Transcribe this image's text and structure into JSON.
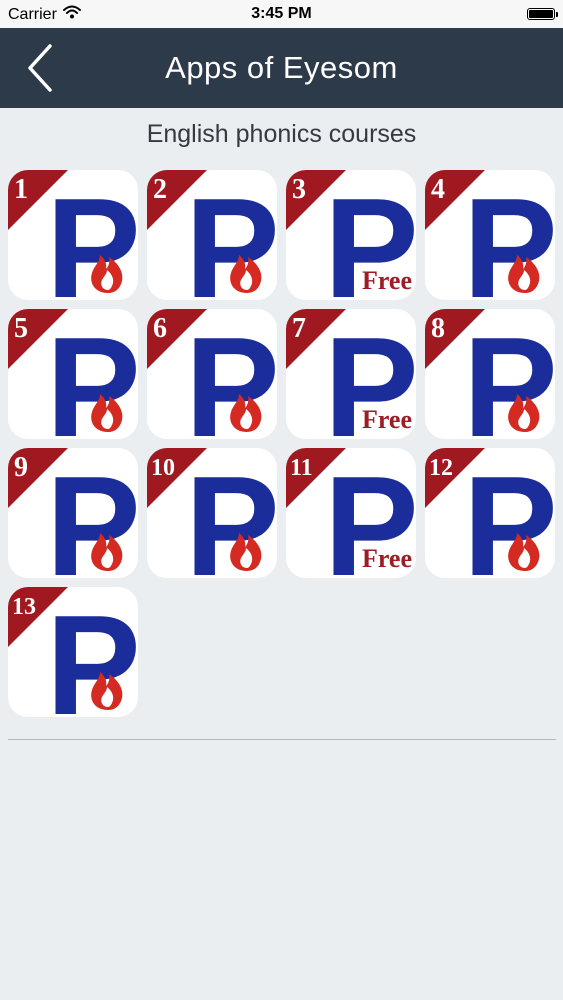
{
  "status_bar": {
    "carrier": "Carrier",
    "time": "3:45 PM"
  },
  "nav": {
    "title": "Apps of Eyesom",
    "back_icon": "chevron-left-icon"
  },
  "section": {
    "title": "English phonics courses"
  },
  "colors": {
    "nav_background": "#2d3a49",
    "page_background": "#ebeef0",
    "badge_red": "#a01820",
    "p_blue": "#1a2d9a",
    "flame_red": "#d42a21"
  },
  "apps": [
    {
      "number": "1",
      "letter": "P",
      "corner": "flame-icon"
    },
    {
      "number": "2",
      "letter": "P",
      "corner": "flame-icon"
    },
    {
      "number": "3",
      "letter": "P",
      "corner": "free",
      "free_label": "Free"
    },
    {
      "number": "4",
      "letter": "P",
      "corner": "flame-icon"
    },
    {
      "number": "5",
      "letter": "P",
      "corner": "flame-icon"
    },
    {
      "number": "6",
      "letter": "P",
      "corner": "flame-icon"
    },
    {
      "number": "7",
      "letter": "P",
      "corner": "free",
      "free_label": "Free"
    },
    {
      "number": "8",
      "letter": "P",
      "corner": "flame-icon"
    },
    {
      "number": "9",
      "letter": "P",
      "corner": "flame-icon"
    },
    {
      "number": "10",
      "letter": "P",
      "corner": "flame-icon"
    },
    {
      "number": "11",
      "letter": "P",
      "corner": "free",
      "free_label": "Free"
    },
    {
      "number": "12",
      "letter": "P",
      "corner": "flame-icon"
    },
    {
      "number": "13",
      "letter": "P",
      "corner": "flame-icon"
    }
  ]
}
